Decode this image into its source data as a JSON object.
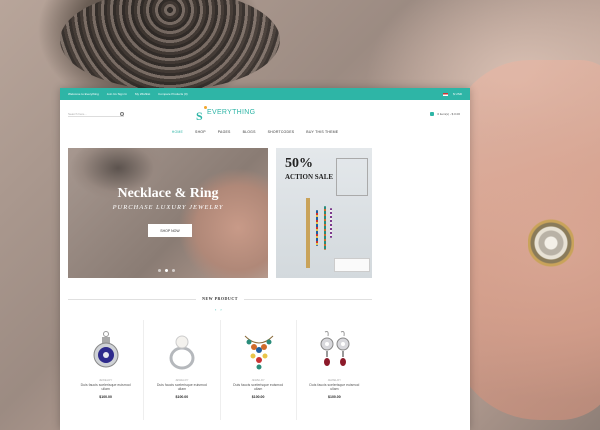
{
  "topbar": {
    "links": [
      "Welcome to Everything",
      "Join Us Sign In",
      "My Wishlist",
      "Compare Products (0)"
    ],
    "currency": "$ USD"
  },
  "header": {
    "search_placeholder": "Search here...",
    "logo_mark": "S",
    "logo_text": "EVERYTHING",
    "cart_text": "0 item(s) - $ 0.00"
  },
  "nav": [
    "HOME",
    "SHOP",
    "PAGES",
    "BLOGS",
    "SHORTCODES",
    "BUY THIS THEME"
  ],
  "banner": {
    "title": "Necklace & Ring",
    "subtitle": "PURCHASE LUXURY JEWELRY",
    "button": "SHOP NOW"
  },
  "side_banner": {
    "percent": "50%",
    "label": "ACTION SALE"
  },
  "section": {
    "title": "NEW PRODUCT",
    "prev": "‹",
    "next": "›"
  },
  "products": [
    {
      "category": "JEWELRY",
      "name": "Duis faucis scelerisque euismod ullam",
      "price": "$100.00"
    },
    {
      "category": "JEWELRY",
      "name": "Duis faucis scelerisque euismod ullam",
      "price": "$100.00"
    },
    {
      "category": "JEWELRY",
      "name": "Duis faucis scelerisque euismod ullam",
      "price": "$100.00"
    },
    {
      "category": "JEWELRY",
      "name": "Duis faucis scelerisque euismod ullam",
      "price": "$100.00"
    }
  ],
  "colors": {
    "accent": "#2eb5a6",
    "logo_dot": "#f2a72e"
  }
}
